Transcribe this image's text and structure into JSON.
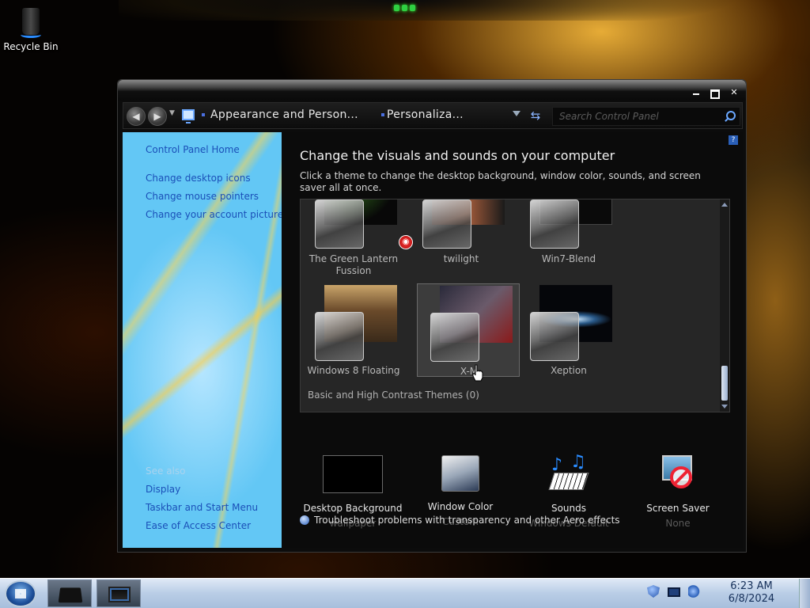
{
  "desktop": {
    "icons": [
      {
        "label": "Recycle Bin",
        "icon": "recycle-bin-icon"
      }
    ]
  },
  "window": {
    "buttons": {
      "minimize": "minimize-icon",
      "maximize": "maximize-icon",
      "close": "✕"
    }
  },
  "address": {
    "crumbs": [
      "Appearance and Person...",
      "Personaliza..."
    ],
    "search_placeholder": "Search Control Panel"
  },
  "sidebar": {
    "home": "Control Panel Home",
    "links": [
      "Change desktop icons",
      "Change mouse pointers",
      "Change your account picture"
    ],
    "see_also_title": "See also",
    "see_also": [
      "Display",
      "Taskbar and Start Menu",
      "Ease of Access Center"
    ]
  },
  "main": {
    "title": "Change the visuals and sounds on your computer",
    "description": "Click a theme to change the desktop background, window color, sounds, and screen saver all at once.",
    "themes": [
      {
        "label": "The Green Lantern Fussion"
      },
      {
        "label": "twilight"
      },
      {
        "label": "Win7-Blend"
      },
      {
        "label": "Windows 8 Floating"
      },
      {
        "label": "X-M",
        "selected": true
      },
      {
        "label": "Xeption"
      }
    ],
    "basic_group_label": "Basic and High Contrast Themes (0)",
    "options": [
      {
        "label": "Desktop Background",
        "value": "wallpaper"
      },
      {
        "label": "Window Color",
        "value": "Custom"
      },
      {
        "label": "Sounds",
        "value": "Windows Default"
      },
      {
        "label": "Screen Saver",
        "value": "None"
      }
    ],
    "troubleshoot": "Troubleshoot problems with transparency and other Aero effects"
  },
  "taskbar": {
    "time": "6:23 AM",
    "date": "6/8/2024",
    "items": [
      "windows-explorer",
      "control-panel"
    ]
  },
  "colors": {
    "link": "#1a4fb8",
    "sidebar_bg": "#6dc9f2",
    "window_bg": "#0b0b0b",
    "taskbar": "#b9cde6"
  }
}
